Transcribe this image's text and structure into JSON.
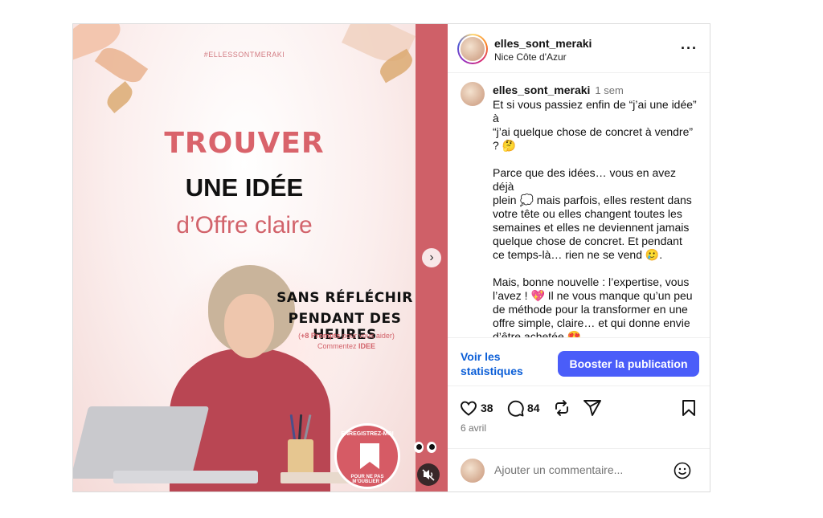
{
  "colors": {
    "accent": "#d9636b",
    "boost_button": "#4a5df9",
    "link": "#0b5ed7",
    "muted": "#737373"
  },
  "post": {
    "image": {
      "hashtag": "#ELLESSONTMERAKI",
      "title_line1": "TROUVER",
      "title_line2": "UNE IDÉE",
      "title_line3": "d’Offre claire",
      "subtitle_line1": "SANS RÉFLÉCHIR",
      "subtitle_line2": "PENDANT DES HEURES",
      "prompts_note_bold": "+8 Prompts",
      "prompts_note_rest": " pour vous aider)",
      "prompts_note_open": "(",
      "comment_prefix": "Commentez ",
      "comment_keyword": "IDEE",
      "badge_top": "ENREGISTREZ-MOI",
      "badge_bottom": "POUR NE PAS M’OUBLIER !"
    },
    "header": {
      "username": "elles_sont_meraki",
      "location": "Nice Côte d'Azur",
      "more_icon": "more-icon"
    },
    "caption": {
      "username": "elles_sont_meraki",
      "time": "1 sem",
      "paragraphs": [
        [
          "Et si vous passiez enfin de “j’ai une idée”",
          "à",
          "“j’ai quelque chose de concret à vendre”",
          "? 🤔"
        ],
        [
          "Parce que des idées… vous en avez déjà",
          "plein 💭 mais parfois, elles restent dans",
          "votre tête ou elles changent toutes les",
          "semaines et elles ne deviennent jamais",
          "quelque chose de concret. Et pendant",
          "ce temps-là… rien ne se vend 🥲."
        ],
        [
          "Mais, bonne nouvelle : l’expertise, vous",
          "l’avez ! 💖 Il ne vous manque qu’un peu",
          "de méthode pour la transformer en une",
          "offre simple, claire… et qui donne envie",
          "d’être achetée 😍"
        ]
      ]
    },
    "insights": {
      "stats_label": "Voir les statistiques",
      "boost_label": "Booster la publication"
    },
    "actions": {
      "likes": "38",
      "comments": "84",
      "date": "6 avril"
    },
    "comment": {
      "placeholder": "Ajouter un commentaire..."
    }
  }
}
